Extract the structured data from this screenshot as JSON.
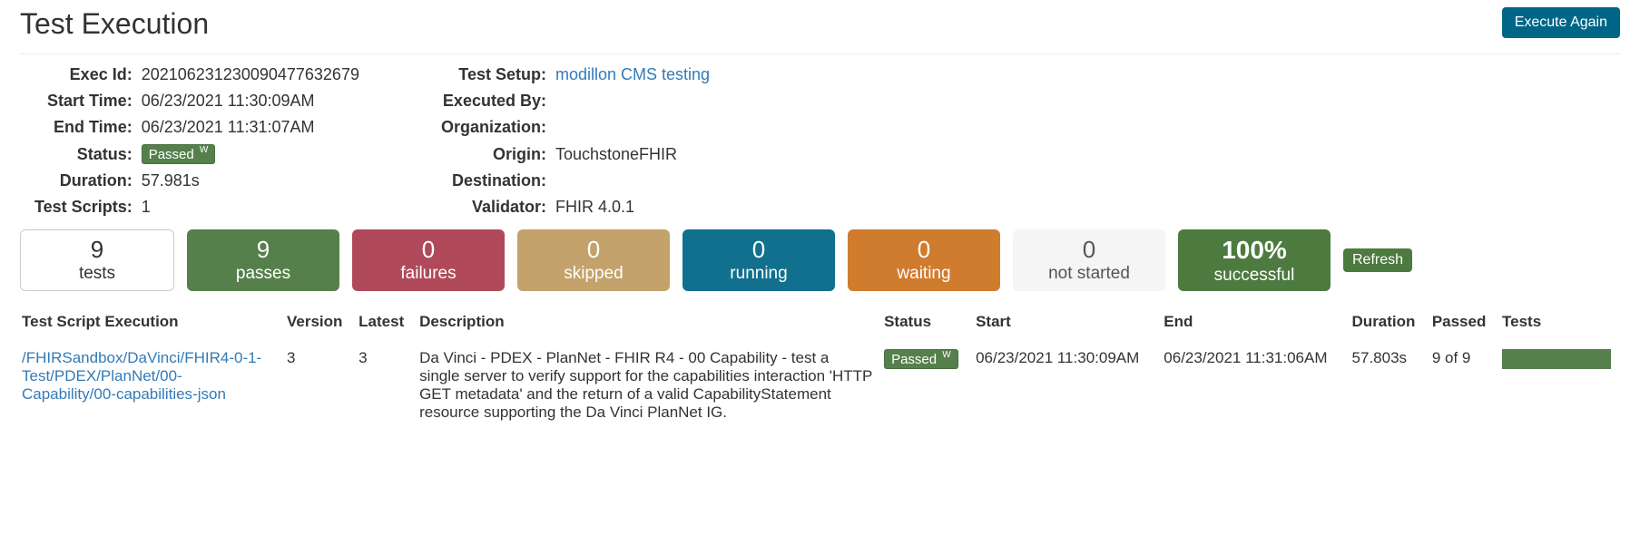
{
  "header": {
    "title": "Test Execution",
    "execute_again": "Execute Again"
  },
  "details": {
    "left": {
      "exec_id_label": "Exec Id:",
      "exec_id": "20210623123009047763​2679",
      "start_label": "Start Time:",
      "start": "06/23/2021 11:30:09AM",
      "end_label": "End Time:",
      "end": "06/23/2021 11:31:07AM",
      "status_label": "Status:",
      "status_badge": "Passed",
      "status_sup": "W",
      "duration_label": "Duration:",
      "duration": "57.981s",
      "scripts_label": "Test Scripts:",
      "scripts": "1"
    },
    "right": {
      "setup_label": "Test Setup:",
      "setup": "modillon CMS testing",
      "executed_by_label": "Executed By:",
      "executed_by": "",
      "org_label": "Organization:",
      "org": "",
      "origin_label": "Origin:",
      "origin": "TouchstoneFHIR",
      "dest_label": "Destination:",
      "dest": "",
      "validator_label": "Validator:",
      "validator": "FHIR 4.0.1"
    }
  },
  "stats": {
    "tests_n": "9",
    "tests_l": "tests",
    "passes_n": "9",
    "passes_l": "passes",
    "fail_n": "0",
    "fail_l": "failures",
    "skip_n": "0",
    "skip_l": "skipped",
    "run_n": "0",
    "run_l": "running",
    "wait_n": "0",
    "wait_l": "waiting",
    "ns_n": "0",
    "ns_l": "not started",
    "succ_n": "100%",
    "succ_l": "successful",
    "refresh": "Refresh"
  },
  "table": {
    "h": {
      "script": "Test Script Execution",
      "version": "Version",
      "latest": "Latest",
      "desc": "Description",
      "status": "Status",
      "start": "Start",
      "end": "End",
      "duration": "Duration",
      "passed": "Passed",
      "tests": "Tests"
    },
    "row": {
      "script": "/FHIRSandbox/DaVinci/FHIR4-0-1-Test/PDEX/PlanNet/00-Capability/00-capabilities-json",
      "version": "3",
      "latest": "3",
      "desc": "Da Vinci - PDEX - PlanNet - FHIR R4 - 00 Capability - test a single server to verify support for the capabilities interaction 'HTTP GET metadata' and the return of a valid CapabilityStatement resource supporting the Da Vinci PlanNet IG.",
      "status": "Passed",
      "status_sup": "W",
      "start": "06/23/2021 11:30:09AM",
      "end": "06/23/2021 11:31:06AM",
      "duration": "57.803s",
      "passed": "9 of 9"
    }
  }
}
